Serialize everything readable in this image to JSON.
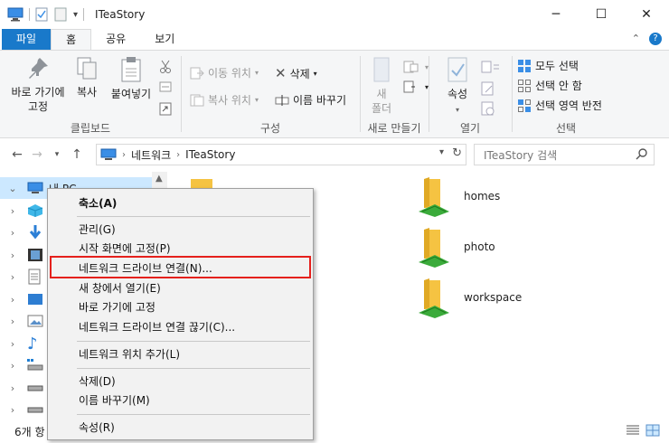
{
  "window": {
    "title": "ITeaStory",
    "controls": {
      "minimize": "─",
      "maximize": "☐",
      "close": "✕"
    }
  },
  "ribbon_tabs": {
    "file": "파일",
    "home": "홈",
    "share": "공유",
    "view": "보기"
  },
  "ribbon": {
    "clipboard": {
      "label": "클립보드",
      "pin_line1": "바로 가기에",
      "pin_line2": "고정",
      "copy": "복사",
      "paste": "붙여넣기"
    },
    "organize": {
      "label": "구성",
      "move_to": "이동 위치",
      "copy_to": "복사 위치",
      "delete": "삭제",
      "rename": "이름 바꾸기"
    },
    "new": {
      "label": "새로 만들기",
      "new_folder_line1": "새",
      "new_folder_line2": "폴더"
    },
    "open": {
      "label": "열기",
      "properties": "속성"
    },
    "select": {
      "label": "선택",
      "select_all": "모두 선택",
      "select_none": "선택 안 함",
      "invert": "선택 영역 반전"
    }
  },
  "address": {
    "crumbs": [
      "네트워크",
      "ITeaStory"
    ],
    "search_placeholder": "ITeaStory 검색"
  },
  "navpane": {
    "this_pc": "내 PC"
  },
  "content": {
    "items": [
      {
        "name": "homes"
      },
      {
        "name": "photo"
      },
      {
        "name": "workspace"
      }
    ]
  },
  "statusbar": {
    "item_count": "6개 항"
  },
  "context_menu": {
    "collapse": "축소(A)",
    "manage": "관리(G)",
    "pin_start": "시작 화면에 고정(P)",
    "map_drive": "네트워크 드라이브 연결(N)...",
    "open_new_window": "새 창에서 열기(E)",
    "pin_quick": "바로 가기에 고정",
    "disconnect_drive": "네트워크 드라이브 연결 끊기(C)...",
    "add_network_location": "네트워크 위치 추가(L)",
    "delete": "삭제(D)",
    "rename": "이름 바꾸기(M)",
    "properties": "속성(R)"
  },
  "colors": {
    "file_tab": "#1979ca",
    "highlight_box": "#e5201c",
    "selection": "#cce8ff",
    "folder": "#f5c342",
    "network_green": "#3bab3b"
  }
}
